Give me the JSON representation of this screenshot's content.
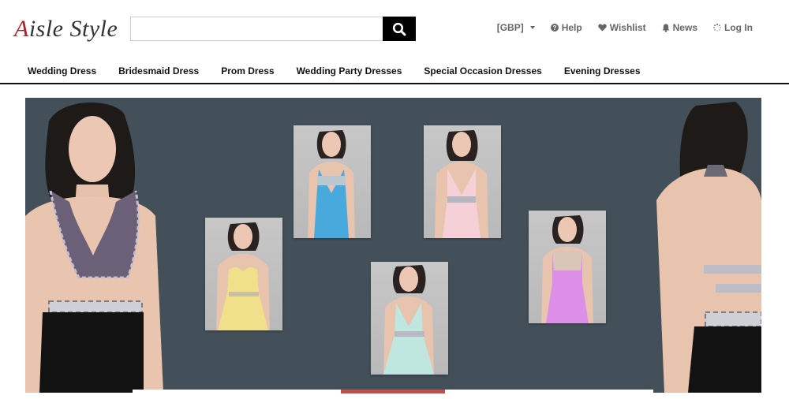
{
  "header": {
    "logo_first": "A",
    "logo_rest": "isle Style",
    "search_placeholder": "",
    "utility": {
      "currency": "[GBP]",
      "help": "Help",
      "wishlist": "Wishlist",
      "news": "News",
      "login": "Log In"
    }
  },
  "nav": {
    "items": [
      "Wedding Dress",
      "Bridesmaid Dress",
      "Prom Dress",
      "Wedding Party Dresses",
      "Special Occasion Dresses",
      "Evening Dresses"
    ]
  },
  "colors": {
    "brand_red": "#b01f2c",
    "hero_bg": "#435059",
    "slider_active": "#c0504d",
    "dress_yellow": "#f0e08a",
    "dress_blue": "#48a9dc",
    "dress_pink": "#f5d0d6",
    "dress_mint": "#bfe6df",
    "dress_lilac": "#dc8fe6"
  },
  "icons": {
    "search": "search-icon",
    "help": "question-circle-icon",
    "wishlist": "heart-icon",
    "news": "bell-icon",
    "login": "spinner-icon"
  }
}
